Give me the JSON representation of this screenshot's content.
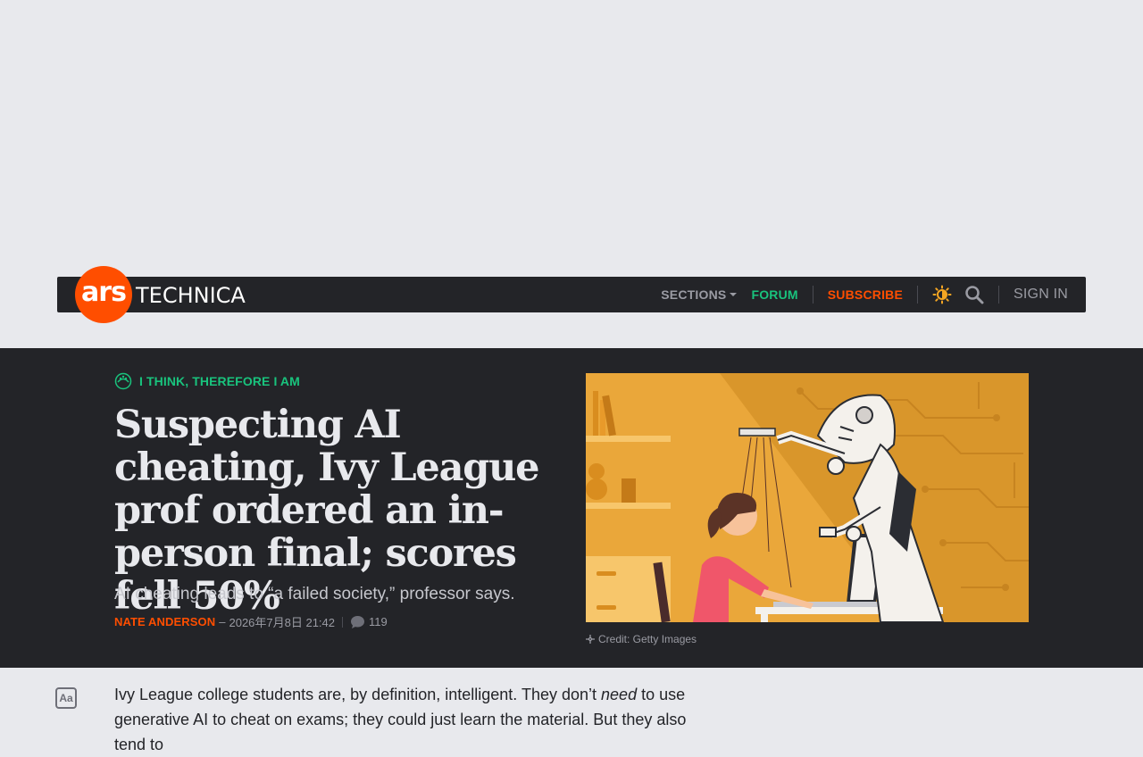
{
  "nav": {
    "logo_mark": "ars",
    "logo_word": "TECHNICA",
    "sections_label": "SECTIONS",
    "forum_label": "FORUM",
    "subscribe_label": "SUBSCRIBE",
    "signin_label": "SIGN IN"
  },
  "article": {
    "kicker": "I THINK, THEREFORE I AM",
    "headline": "Suspecting AI cheating, Ivy League prof ordered an in-person final; scores fell 50%",
    "dek": "AI cheating leads to “a failed society,” professor says.",
    "author": "NATE ANDERSON",
    "separator": "–",
    "date": "2026年7月8日 21:42",
    "comment_count": "119",
    "image_credit": "Credit: Getty Images",
    "body_part1": "Ivy League college students are, by definition, intelligent. They don’t ",
    "body_em": "need",
    "body_part2": " to use generative AI to cheat on exams; they could just learn the material. But they also tend to"
  },
  "text_size_button": "Aa",
  "colors": {
    "brand_orange": "#ff4e00",
    "accent_green": "#19c37d",
    "dark_bg": "#232428",
    "page_bg": "#e8e9ed"
  }
}
